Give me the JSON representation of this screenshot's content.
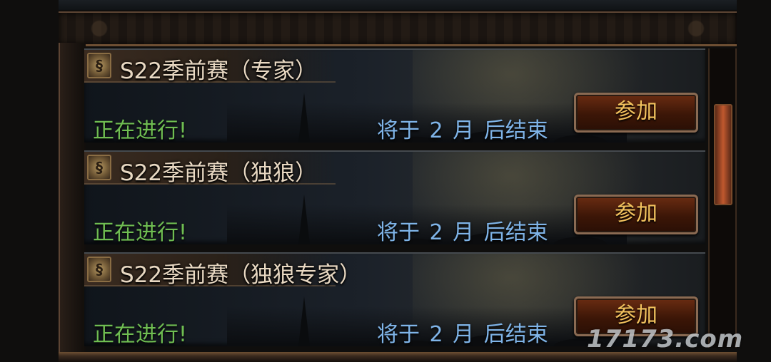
{
  "events": [
    {
      "title": "S22季前赛（专家）",
      "status": "正在进行!",
      "ends": "将于 2 月 后结束",
      "join_label": "参加"
    },
    {
      "title": "S22季前赛（独狼）",
      "status": "正在进行!",
      "ends": "将于 2 月 后结束",
      "join_label": "参加"
    },
    {
      "title": "S22季前赛（独狼专家）",
      "status": "正在进行!",
      "ends": "将于 2 月 后结束",
      "join_label": "参加"
    }
  ],
  "watermark": "17173.com",
  "colors": {
    "status_green": "#6fbd52",
    "ends_blue": "#7fb4e8",
    "title_text": "#e8d8c2",
    "button_text": "#f2c25e",
    "button_bg": "#4a1c0a",
    "scroll_thumb": "#c0582e"
  },
  "icons": {
    "season_badge": "season-badge-icon"
  }
}
